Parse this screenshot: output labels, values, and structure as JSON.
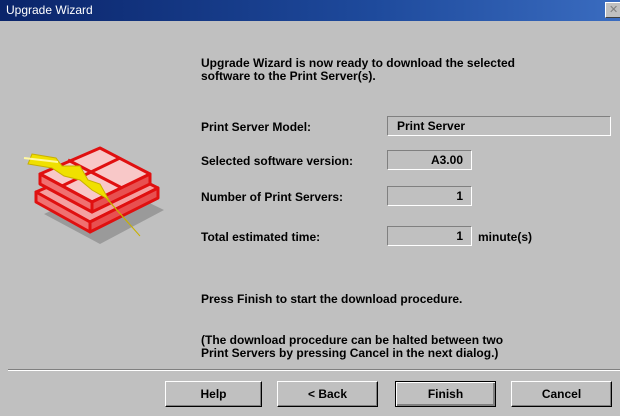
{
  "window": {
    "title": "Upgrade Wizard",
    "close_glyph": "✕"
  },
  "intro_text": [
    "Upgrade Wizard is now ready to download the selected",
    "software to the Print Server(s)."
  ],
  "fields": [
    {
      "label": "Print Server Model:",
      "value": "Print Server"
    },
    {
      "label": "Selected software version:",
      "value": "A3.00"
    },
    {
      "label": "Number of Print Servers:",
      "value": "1"
    },
    {
      "label": "Total estimated time:",
      "value": "1",
      "unit": "minute(s)"
    }
  ],
  "instructions": {
    "finish_text": "Press Finish to start the download procedure.",
    "halt_text": [
      "(The download procedure can be halted between two",
      "Print Servers by pressing Cancel in the next dialog.)"
    ]
  },
  "buttons": {
    "help": "Help",
    "back": "< Back",
    "finish": "Finish",
    "cancel": "Cancel"
  },
  "icons": {
    "wizard_art": "print-server-lightning-icon",
    "close": "close-icon"
  },
  "colors": {
    "titlebar": "#0a246a",
    "dialog_face": "#c0c0c0",
    "art_red": "#e01010",
    "art_yellow": "#f0e000"
  }
}
